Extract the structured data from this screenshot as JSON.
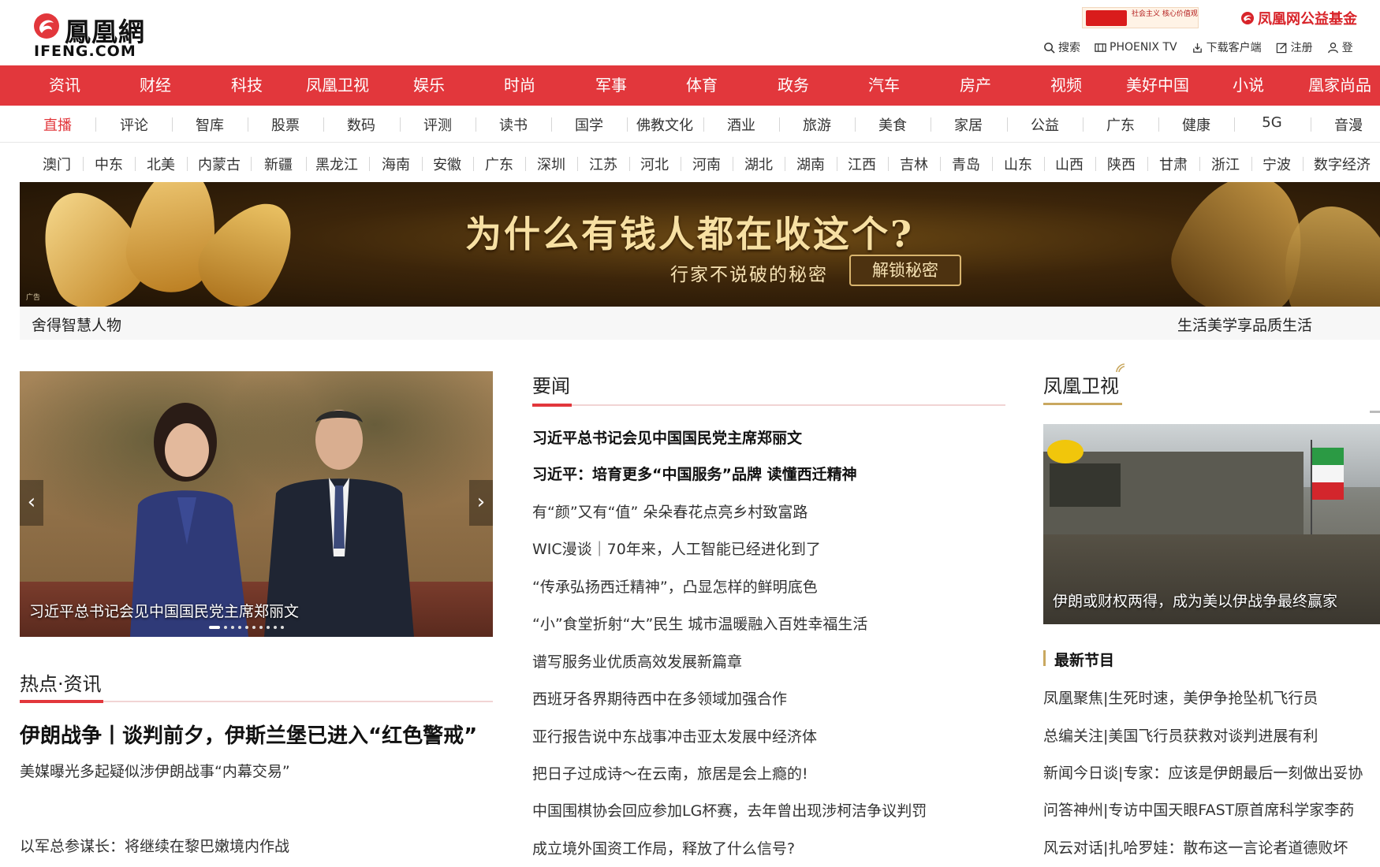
{
  "header": {
    "logo_cn": "鳳凰網",
    "logo_en": "IFENG.COM",
    "promo_left": "社会主义 核心价值观",
    "promo_right": "凤凰网公益基金",
    "util": [
      {
        "icon": "search-icon",
        "label": "搜索"
      },
      {
        "icon": "tv-icon",
        "label": "PHOENIX TV"
      },
      {
        "icon": "download-icon",
        "label": "下载客户端"
      },
      {
        "icon": "edit-icon",
        "label": "注册"
      },
      {
        "icon": "user-icon",
        "label": "登"
      }
    ]
  },
  "main_nav": [
    "资讯",
    "财经",
    "科技",
    "凤凰卫视",
    "娱乐",
    "时尚",
    "军事",
    "体育",
    "政务",
    "汽车",
    "房产",
    "视频",
    "美好中国",
    "小说",
    "凰家尚品"
  ],
  "sub_nav": [
    "直播",
    "评论",
    "智库",
    "股票",
    "数码",
    "评测",
    "读书",
    "国学",
    "佛教文化",
    "酒业",
    "旅游",
    "美食",
    "家居",
    "公益",
    "广东",
    "健康",
    "5G",
    "音漫"
  ],
  "sub_nav_active": "直播",
  "region_nav": [
    "澳门",
    "中东",
    "北美",
    "内蒙古",
    "新疆",
    "黑龙江",
    "海南",
    "安徽",
    "广东",
    "深圳",
    "江苏",
    "河北",
    "河南",
    "湖北",
    "湖南",
    "江西",
    "吉林",
    "青岛",
    "山东",
    "山西",
    "陕西",
    "甘肃",
    "浙江",
    "宁波",
    "数字经济"
  ],
  "banner": {
    "headline": "为什么有钱人都在收这个?",
    "sub": "行家不说破的秘密",
    "button": "解锁秘密",
    "ad_tag": "广告",
    "strip_left": "舍得智慧人物",
    "strip_right": "生活美学享品质生活"
  },
  "slider": {
    "caption": "习近平总书记会见中国国民党主席郑丽文",
    "prev": "‹",
    "next": "›",
    "dot_count": 10,
    "active_dot": 0
  },
  "hot": {
    "title": "热点·资讯",
    "headline": "伊朗战争丨谈判前夕，伊斯兰堡已进入“红色警戒”",
    "sub": "美媒曝光多起疑似涉伊朗战事“内幕交易”",
    "item": "以军总参谋长：将继续在黎巴嫩境内作战"
  },
  "news": {
    "title": "要闻",
    "items": [
      {
        "text": "习近平总书记会见中国国民党主席郑丽文",
        "bold": true
      },
      {
        "text": "习近平：培育更多“中国服务”品牌   读懂西迁精神",
        "bold": true
      },
      {
        "text": "有“颜”又有“值” 朵朵春花点亮乡村致富路",
        "bold": false
      },
      {
        "text": "WIC漫谈｜70年来，人工智能已经进化到了",
        "bold": false
      },
      {
        "text": "“传承弘扬西迁精神”，凸显怎样的鲜明底色",
        "bold": false
      },
      {
        "text": "“小”食堂折射“大”民生 城市温暖融入百姓幸福生活",
        "bold": false
      },
      {
        "text": "谱写服务业优质高效发展新篇章",
        "bold": false
      },
      {
        "text": "西班牙各界期待西中在多领域加强合作",
        "bold": false
      },
      {
        "text": "亚行报告说中东战事冲击亚太发展中经济体",
        "bold": false
      },
      {
        "text": "把日子过成诗～在云南，旅居是会上瘾的!",
        "bold": false
      },
      {
        "text": "中国围棋协会回应参加LG杯赛，去年曾出现涉柯洁争议判罚",
        "bold": false
      },
      {
        "text": "成立境外国资工作局，释放了什么信号?",
        "bold": false
      }
    ]
  },
  "tv": {
    "title": "凤凰卫视",
    "caption": "伊朗或财权两得，成为美以伊战争最终赢家",
    "latest_title": "最新节目",
    "programs": [
      "凤凰聚焦|生死时速，美伊争抢坠机飞行员",
      "总编关注|美国飞行员获救对谈判进展有利",
      "新闻今日谈|专家：应该是伊朗最后一刻做出妥协",
      "问答神州|专访中国天眼FAST原首席科学家李菂",
      "风云对话|扎哈罗娃：散布这一言论者道德败坏"
    ]
  },
  "colors": {
    "brand_red": "#e2373c",
    "gold": "#c9a860"
  }
}
